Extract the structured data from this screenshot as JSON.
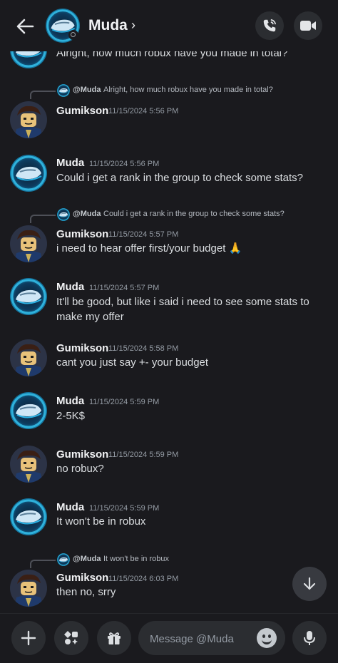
{
  "header": {
    "contact_name": "Muda",
    "chevron": "›"
  },
  "icons": {
    "back": "back-arrow-icon",
    "call": "phone-call-icon",
    "video": "video-camera-icon",
    "scroll": "chevron-down-icon",
    "add": "plus-icon",
    "apps": "apps-icon",
    "gift": "gift-icon",
    "emoji": "emoji-icon",
    "mic": "microphone-icon"
  },
  "colors": {
    "background": "#1a1a1e",
    "muda_avatar": "#0e3a5c",
    "gumikson_avatar": "#2a3a5a"
  },
  "partial_top": {
    "text": "Alright, how much robux have you made in total?"
  },
  "messages": [
    {
      "reply": {
        "name": "@Muda",
        "text": "Alright, how much robux have you made in total?"
      },
      "author": "Gumikson",
      "time": "11/15/2024 5:56 PM",
      "text": ""
    },
    {
      "author": "Muda",
      "time": "11/15/2024 5:56 PM",
      "text": "Could i get a rank in the group to check some stats?"
    },
    {
      "reply": {
        "name": "@Muda",
        "text": "Could i get a rank in the group to check some stats?"
      },
      "author": "Gumikson",
      "time": "11/15/2024 5:57 PM",
      "text": "i need to hear offer first/your budget 🙏"
    },
    {
      "author": "Muda",
      "time": "11/15/2024 5:57 PM",
      "text": "It'll be good, but like i said i need to see some stats to make my offer"
    },
    {
      "author": "Gumikson",
      "time": "11/15/2024 5:58 PM",
      "text": "cant you just say +- your budget"
    },
    {
      "author": "Muda",
      "time": "11/15/2024 5:59 PM",
      "text": "2-5K$"
    },
    {
      "author": "Gumikson",
      "time": "11/15/2024 5:59 PM",
      "text": "no robux?"
    },
    {
      "author": "Muda",
      "time": "11/15/2024 5:59 PM",
      "text": "It won't be in robux"
    },
    {
      "reply": {
        "name": "@Muda",
        "text": "It won't be in robux"
      },
      "author": "Gumikson",
      "time": "11/15/2024 6:03 PM",
      "text": "then no, srry"
    }
  ],
  "composer": {
    "placeholder": "Message @Muda"
  }
}
